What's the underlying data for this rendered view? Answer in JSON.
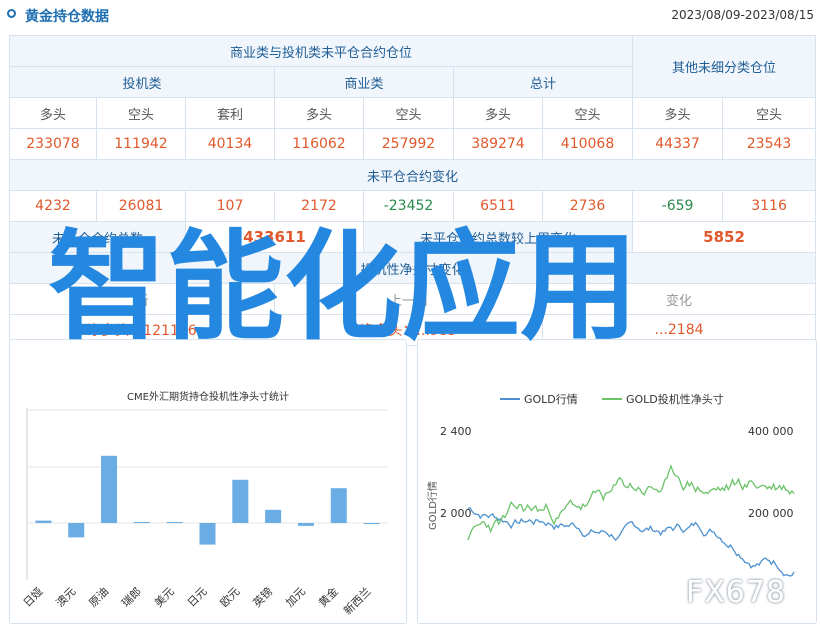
{
  "header": {
    "title": "黄金持仓数据",
    "date_range": "2023/08/09-2023/08/15"
  },
  "table": {
    "group_top": "商业类与投机类未平仓合约仓位",
    "group_other": "其他未细分类仓位",
    "sub_groups": [
      "投机类",
      "商业类",
      "总计"
    ],
    "columns": [
      "多头",
      "空头",
      "套利",
      "多头",
      "空头",
      "多头",
      "空头",
      "多头",
      "空头"
    ],
    "positions": [
      "233078",
      "111942",
      "40134",
      "116062",
      "257992",
      "389274",
      "410068",
      "44337",
      "23543"
    ],
    "change_title": "未平仓合约变化",
    "changes": [
      "4232",
      "26081",
      "107",
      "2172",
      "-23452",
      "6511",
      "2736",
      "-659",
      "3116"
    ],
    "total_label": "未平仓合约总数",
    "total_value": "433611",
    "weekly_label": "未平仓合约总数较上周变化",
    "weekly_value": "5852",
    "net_title": "投机性净头寸变化",
    "net_cols": [
      "新",
      "上一周",
      "变化"
    ],
    "net_vals": [
      "净多头：121136",
      "净多头：...985",
      "...2184"
    ]
  },
  "left_chart_title": "CME外汇期货持仓投机性净头寸统计",
  "right_chart_legend": [
    "GOLD行情",
    "GOLD投机性净头寸"
  ],
  "overlay_text": "智能化应用",
  "watermark": "FX678",
  "chart_data": [
    {
      "type": "bar",
      "title": "CME外汇期货持仓投机性净头寸统计",
      "categories": [
        "日娅",
        "澳元",
        "原油",
        "瑞郎",
        "美元",
        "日元",
        "欧元",
        "英镑",
        "加元",
        "黄金",
        "新西兰"
      ],
      "values": [
        1,
        -6,
        28,
        0.3,
        0.3,
        -9,
        18,
        5.5,
        -1.2,
        14.5,
        -0.2
      ],
      "color": "#6aade4"
    },
    {
      "type": "line",
      "y_left_ticks": [
        "2 400",
        "2 000"
      ],
      "y_right_ticks": [
        "400 000",
        "200 000"
      ],
      "y_left_label": "GOLD行情",
      "series": [
        {
          "name": "GOLD行情",
          "color": "#4c91cf"
        },
        {
          "name": "GOLD投机性净头寸",
          "color": "#6cc36a"
        }
      ]
    }
  ],
  "colors": {
    "accent": "#1f6fb2",
    "up": "#e1582b",
    "down": "#2a8a4b"
  }
}
